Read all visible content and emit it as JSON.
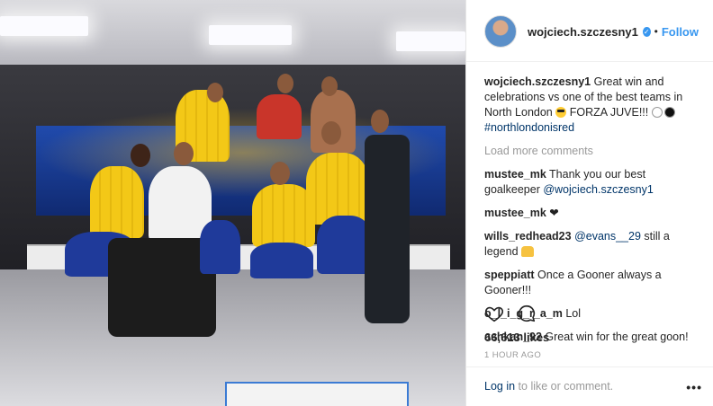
{
  "header": {
    "username": "wojciech.szczesny1",
    "separator": "•",
    "follow_label": "Follow"
  },
  "caption": {
    "username": "wojciech.szczesny1",
    "text": "Great win and celebrations vs one of the best teams in North London",
    "text2": "FORZA JUVE!!!",
    "hashtag": "#northlondonisred"
  },
  "load_more_label": "Load more comments",
  "comments": [
    {
      "username": "mustee_mk",
      "text": "Thank you our best goalkeeper",
      "mention": "@wojciech.szczesny1"
    },
    {
      "username": "mustee_mk",
      "text": "❤"
    },
    {
      "username": "wills_redhead23",
      "mention": "@evans__29",
      "text": "still a legend"
    },
    {
      "username": "speppiatt",
      "text": "Once a Gooner always a Gooner!!!"
    },
    {
      "username": "o_l_i_g_r_a_m",
      "text": "Lol"
    },
    {
      "username": "ashkan_92",
      "text": "Great win for the great goon!"
    }
  ],
  "likes_label": "66,613 likes",
  "time_label": "1 HOUR AGO",
  "login": {
    "link": "Log in",
    "text": "to like or comment."
  },
  "more_label": "•••",
  "icons": {
    "like": "heart-outline-icon",
    "comment": "speech-bubble-icon",
    "verified": "verified-badge-icon"
  },
  "colors": {
    "accent": "#3897f0",
    "mention": "#003569",
    "muted": "#999999"
  }
}
